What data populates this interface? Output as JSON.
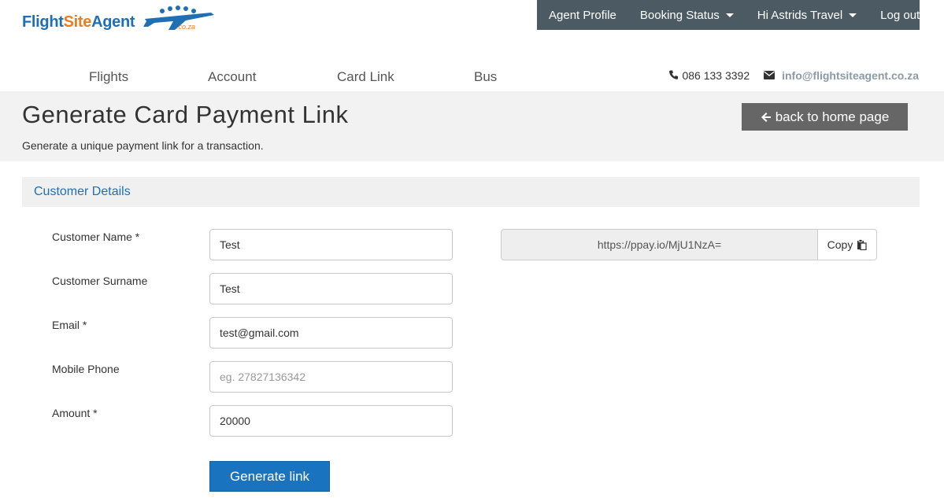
{
  "logo": {
    "part1": "Flight",
    "part2": "Site",
    "part3": "Agent",
    "suffix": ".co.za"
  },
  "topnav": {
    "items": [
      {
        "label": "Agent Profile",
        "dropdown": false
      },
      {
        "label": "Booking Status",
        "dropdown": true
      },
      {
        "label": "Hi Astrids Travel",
        "dropdown": true
      },
      {
        "label": "Log out",
        "dropdown": false
      }
    ]
  },
  "mainmenu": {
    "items": [
      "Flights",
      "Account",
      "Card Link",
      "Bus"
    ]
  },
  "contact": {
    "phone": "086 133 3392",
    "email": "info@flightsiteagent.co.za"
  },
  "header": {
    "title": "Generate Card Payment Link",
    "subtitle": "Generate a unique payment link for a transaction.",
    "back_label": "back to home page"
  },
  "section": {
    "title": "Customer Details"
  },
  "form": {
    "fields": [
      {
        "label": "Customer Name *",
        "value": "Test",
        "placeholder": ""
      },
      {
        "label": "Customer Surname",
        "value": "Test",
        "placeholder": ""
      },
      {
        "label": "Email *",
        "value": "test@gmail.com",
        "placeholder": ""
      },
      {
        "label": "Mobile Phone",
        "value": "",
        "placeholder": "eg. 27827136342"
      },
      {
        "label": "Amount *",
        "value": "20000",
        "placeholder": ""
      }
    ],
    "submit_label": "Generate link"
  },
  "link": {
    "url": "https://ppay.io/MjU1NzA=",
    "copy_label": "Copy"
  },
  "colors": {
    "brand_blue": "#1f6fb5",
    "brand_orange": "#e67e22",
    "topnav_bg": "#4b5a63",
    "primary_button": "#1a73bf",
    "back_button": "#666666"
  }
}
